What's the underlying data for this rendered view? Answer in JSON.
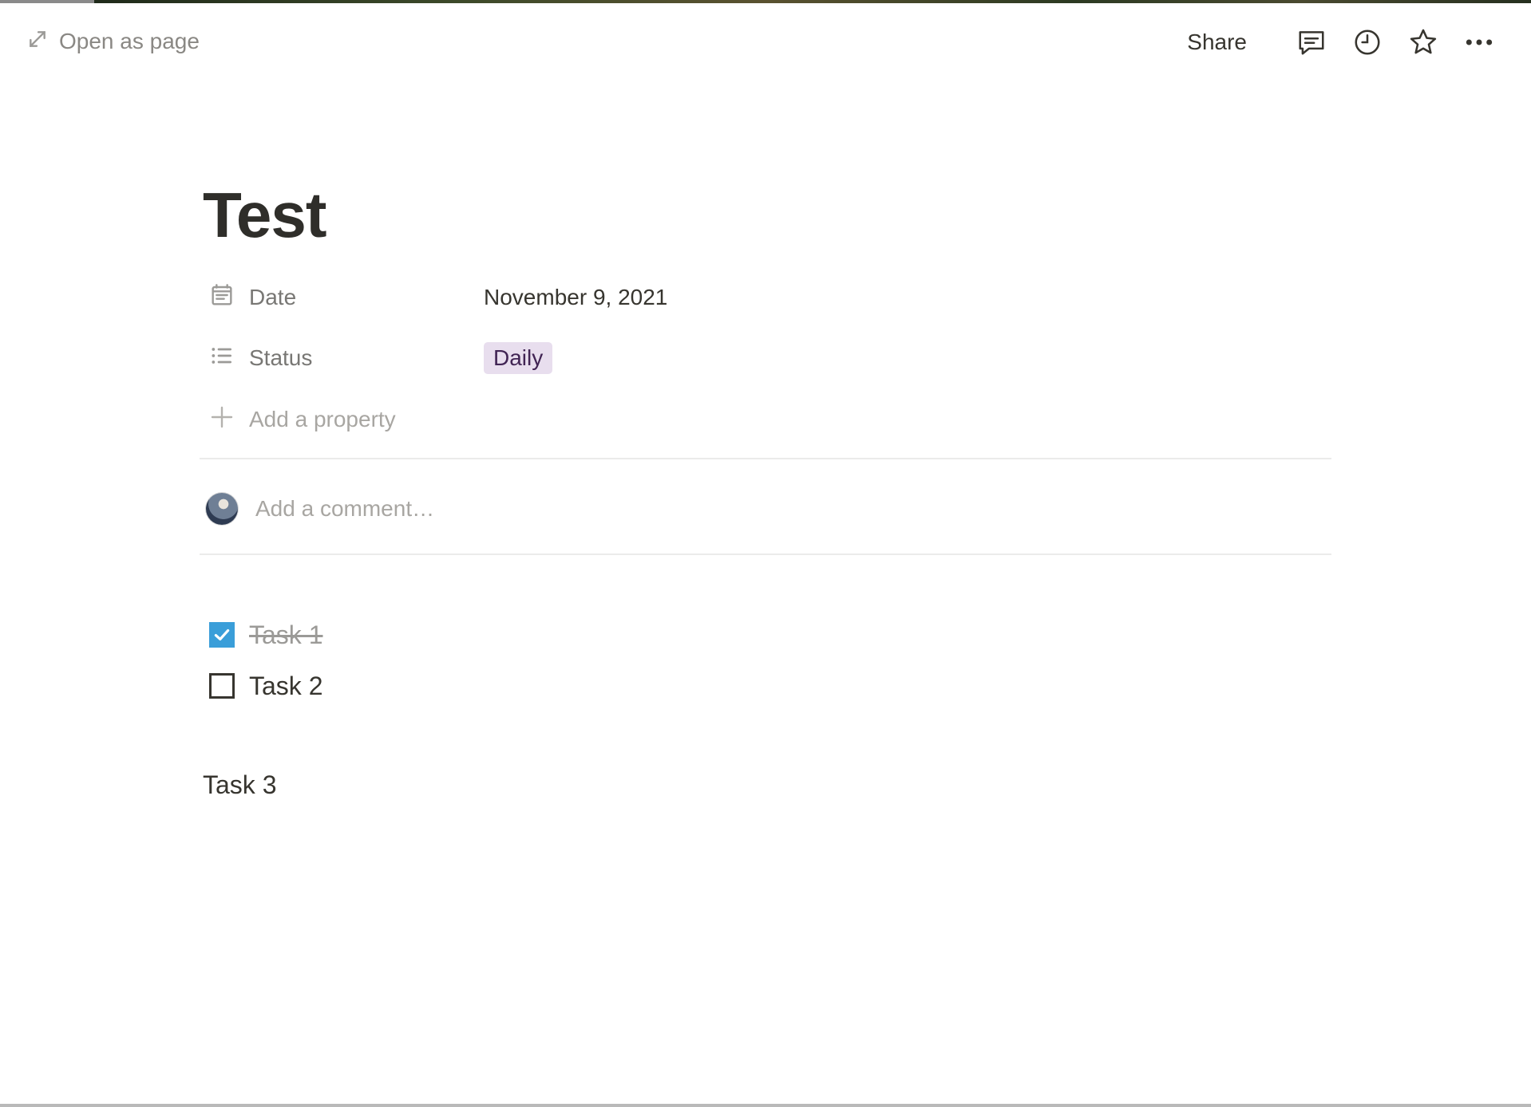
{
  "topbar": {
    "open_as_page": "Open as page",
    "share": "Share",
    "icons": [
      "expand-icon",
      "comment-icon",
      "clock-icon",
      "star-icon",
      "more-icon"
    ]
  },
  "page": {
    "title": "Test",
    "properties": [
      {
        "name": "Date",
        "icon": "calendar-icon",
        "value": "November 9, 2021"
      },
      {
        "name": "Status",
        "icon": "list-icon",
        "value": "Daily",
        "value_color": "#e8deee"
      }
    ],
    "add_property": "Add a property",
    "comment": {
      "placeholder": "Add a comment…"
    },
    "todos": [
      {
        "label": "Task 1",
        "checked": true
      },
      {
        "label": "Task 2",
        "checked": false
      }
    ],
    "paragraph": "Task 3"
  },
  "colors": {
    "accent": "#3a9ed9",
    "text": "#37352f",
    "muted": "#787774"
  }
}
